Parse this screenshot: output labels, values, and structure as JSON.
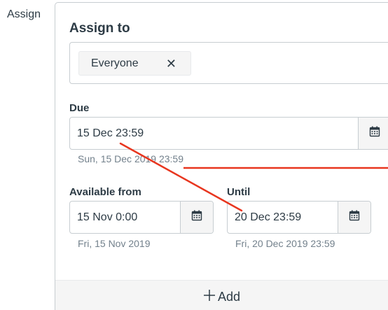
{
  "side_label": "Assign",
  "assign": {
    "title": "Assign to",
    "chips": [
      {
        "label": "Everyone",
        "remove_icon": "close-icon"
      }
    ]
  },
  "due": {
    "label": "Due",
    "value": "15 Dec 23:59",
    "hint": "Sun, 15 Dec 2019 23:59",
    "button_icon": "calendar-icon"
  },
  "available_from": {
    "label": "Available from",
    "value": "15 Nov 0:00",
    "hint": "Fri, 15 Nov 2019",
    "button_icon": "calendar-icon"
  },
  "until": {
    "label": "Until",
    "value": "20 Dec 23:59",
    "hint": "Fri, 20 Dec 2019 23:59",
    "button_icon": "calendar-icon"
  },
  "add": {
    "label": "Add",
    "icon": "plus-icon"
  },
  "colors": {
    "annotation_line": "#e8361f",
    "text": "#2d3b45",
    "hint_text": "#73818c",
    "border": "#c7cdd1"
  }
}
